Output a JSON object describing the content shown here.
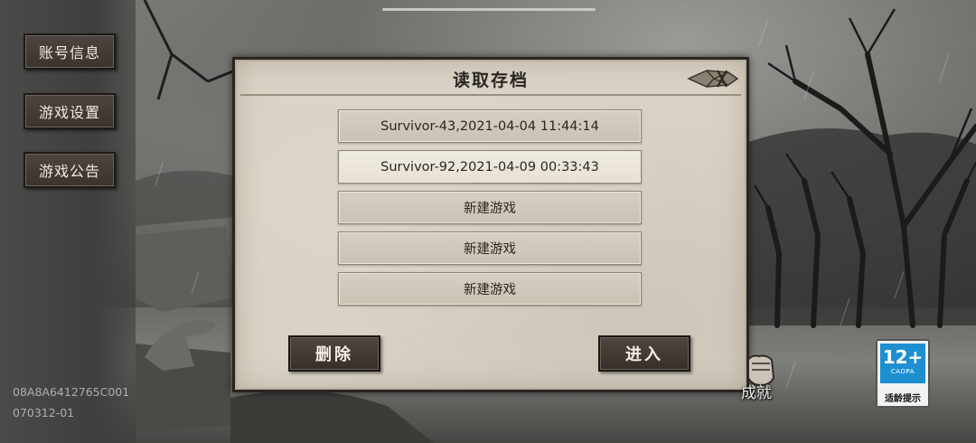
{
  "sidebar": {
    "account_info": "账号信息",
    "game_settings": "游戏设置",
    "game_notice": "游戏公告"
  },
  "device": {
    "id": "08A8A6412765C001",
    "version": "070312-01"
  },
  "dialog": {
    "title": "读取存档",
    "slots": [
      {
        "label": "Survivor-43,2021-04-04 11:44:14",
        "selected": false
      },
      {
        "label": "Survivor-92,2021-04-09 00:33:43",
        "selected": true
      },
      {
        "label": "新建游戏",
        "selected": false
      },
      {
        "label": "新建游戏",
        "selected": false
      },
      {
        "label": "新建游戏",
        "selected": false
      }
    ],
    "delete_label": "删除",
    "enter_label": "进入"
  },
  "achievement": {
    "label": "成就"
  },
  "age_rating": {
    "rating": "12+",
    "org": "CADPA",
    "tip": "适龄提示",
    "color": "#1e8fd0"
  }
}
